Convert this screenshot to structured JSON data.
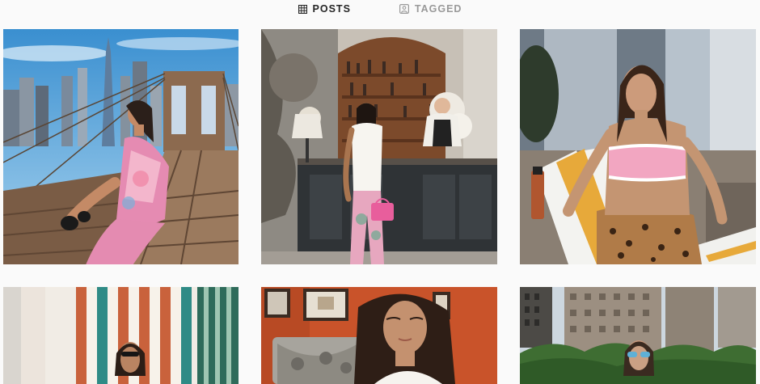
{
  "profile_tabs": {
    "posts_label": "POSTS",
    "posts_icon": "grid-icon",
    "tagged_label": "TAGGED",
    "tagged_icon": "tag-person-icon",
    "active_tab": "posts"
  },
  "posts": [
    {
      "scene": "brooklyn-bridge-city-skyline"
    },
    {
      "scene": "bar-interior-woman-white-top"
    },
    {
      "scene": "poolside-woman-pink-bandeau"
    },
    {
      "scene": "striped-awning-sunglasses"
    },
    {
      "scene": "orange-wall-portrait"
    },
    {
      "scene": "city-rooftop-sunglasses"
    }
  ]
}
